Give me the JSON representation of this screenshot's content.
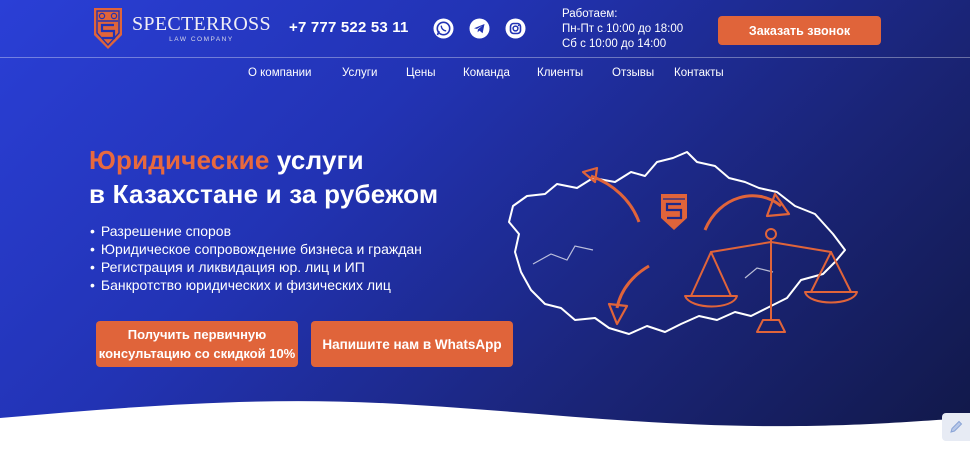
{
  "brand": {
    "name": "SPECTERROSS",
    "subtitle": "LAW COMPANY",
    "accent_color": "#e0643a",
    "background_color": "#2233b4"
  },
  "header": {
    "phone": "+7 777 522 53 11",
    "socials": [
      "whatsapp-icon",
      "telegram-icon",
      "instagram-icon"
    ],
    "hours": {
      "title": "Работаем:",
      "weekdays": "Пн-Пт с 10:00 до 18:00",
      "saturday": "Сб с 10:00 до 14:00"
    },
    "cta_label": "Заказать звонок"
  },
  "nav": {
    "items": [
      "О компании",
      "Услуги",
      "Цены",
      "Команда",
      "Клиенты",
      "Отзывы",
      "Контакты"
    ]
  },
  "hero": {
    "title_accent": "Юридические",
    "title_rest": " услуги",
    "title_line2": "в Казахстане и за рубежом",
    "bullets": [
      "Разрешение споров",
      "Юридическое сопровождение бизнеса и граждан",
      "Регистрация и ликвидация юр. лиц и ИП",
      "Банкротство юридических и физических лиц"
    ],
    "button_consult_line1": "Получить первичную",
    "button_consult_line2": "консультацию со скидкой 10%",
    "button_whatsapp": "Напишите нам в WhatsApp"
  }
}
